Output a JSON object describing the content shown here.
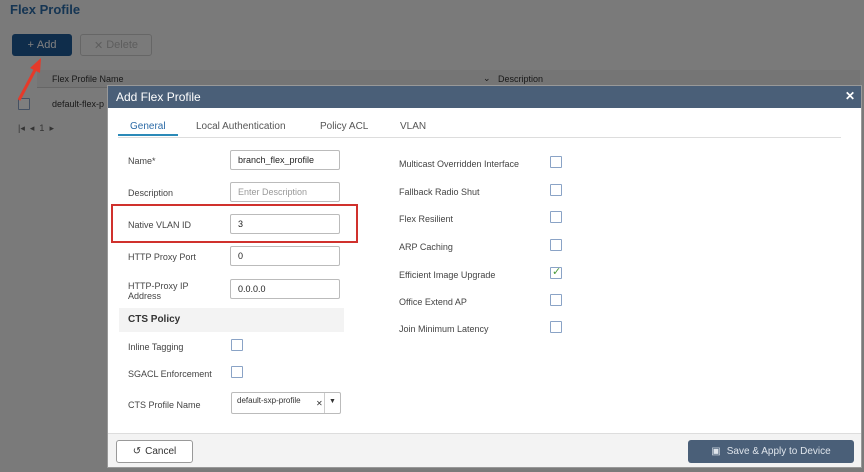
{
  "page": {
    "title": "Flex Profile",
    "add_label": "Add",
    "delete_label": "Delete"
  },
  "table": {
    "columns": [
      "Flex Profile Name",
      "Description"
    ],
    "rows": [
      {
        "name": "default-flex-p"
      }
    ],
    "page": "1"
  },
  "modal": {
    "title": "Add Flex Profile",
    "tabs": [
      {
        "label": "General",
        "active": true
      },
      {
        "label": "Local Authentication"
      },
      {
        "label": "Policy ACL"
      },
      {
        "label": "VLAN"
      }
    ],
    "fields": {
      "name_label": "Name*",
      "name_value": "branch_flex_profile",
      "description_label": "Description",
      "description_placeholder": "Enter Description",
      "native_vlan_label": "Native VLAN ID",
      "native_vlan_value": "3",
      "http_proxy_port_label": "HTTP Proxy Port",
      "http_proxy_port_value": "0",
      "http_proxy_ip_label": "HTTP-Proxy IP Address",
      "http_proxy_ip_value": "0.0.0.0"
    },
    "cts": {
      "section": "CTS Policy",
      "inline_tagging_label": "Inline Tagging",
      "inline_tagging": false,
      "sgacl_label": "SGACL Enforcement",
      "sgacl": false,
      "profile_name_label": "CTS Profile Name",
      "profile_name_value": "default-sxp-profile"
    },
    "options": [
      {
        "label": "Multicast Overridden Interface",
        "checked": false
      },
      {
        "label": "Fallback Radio Shut",
        "checked": false
      },
      {
        "label": "Flex Resilient",
        "checked": false
      },
      {
        "label": "ARP Caching",
        "checked": false
      },
      {
        "label": "Efficient Image Upgrade",
        "checked": true
      },
      {
        "label": "Office Extend AP",
        "checked": false
      },
      {
        "label": "Join Minimum Latency",
        "checked": false
      }
    ],
    "cancel_label": "Cancel",
    "save_label": "Save & Apply to Device"
  },
  "colors": {
    "header": "#4a5f78",
    "accent": "#2b6aa6",
    "highlight": "#d0312d"
  }
}
